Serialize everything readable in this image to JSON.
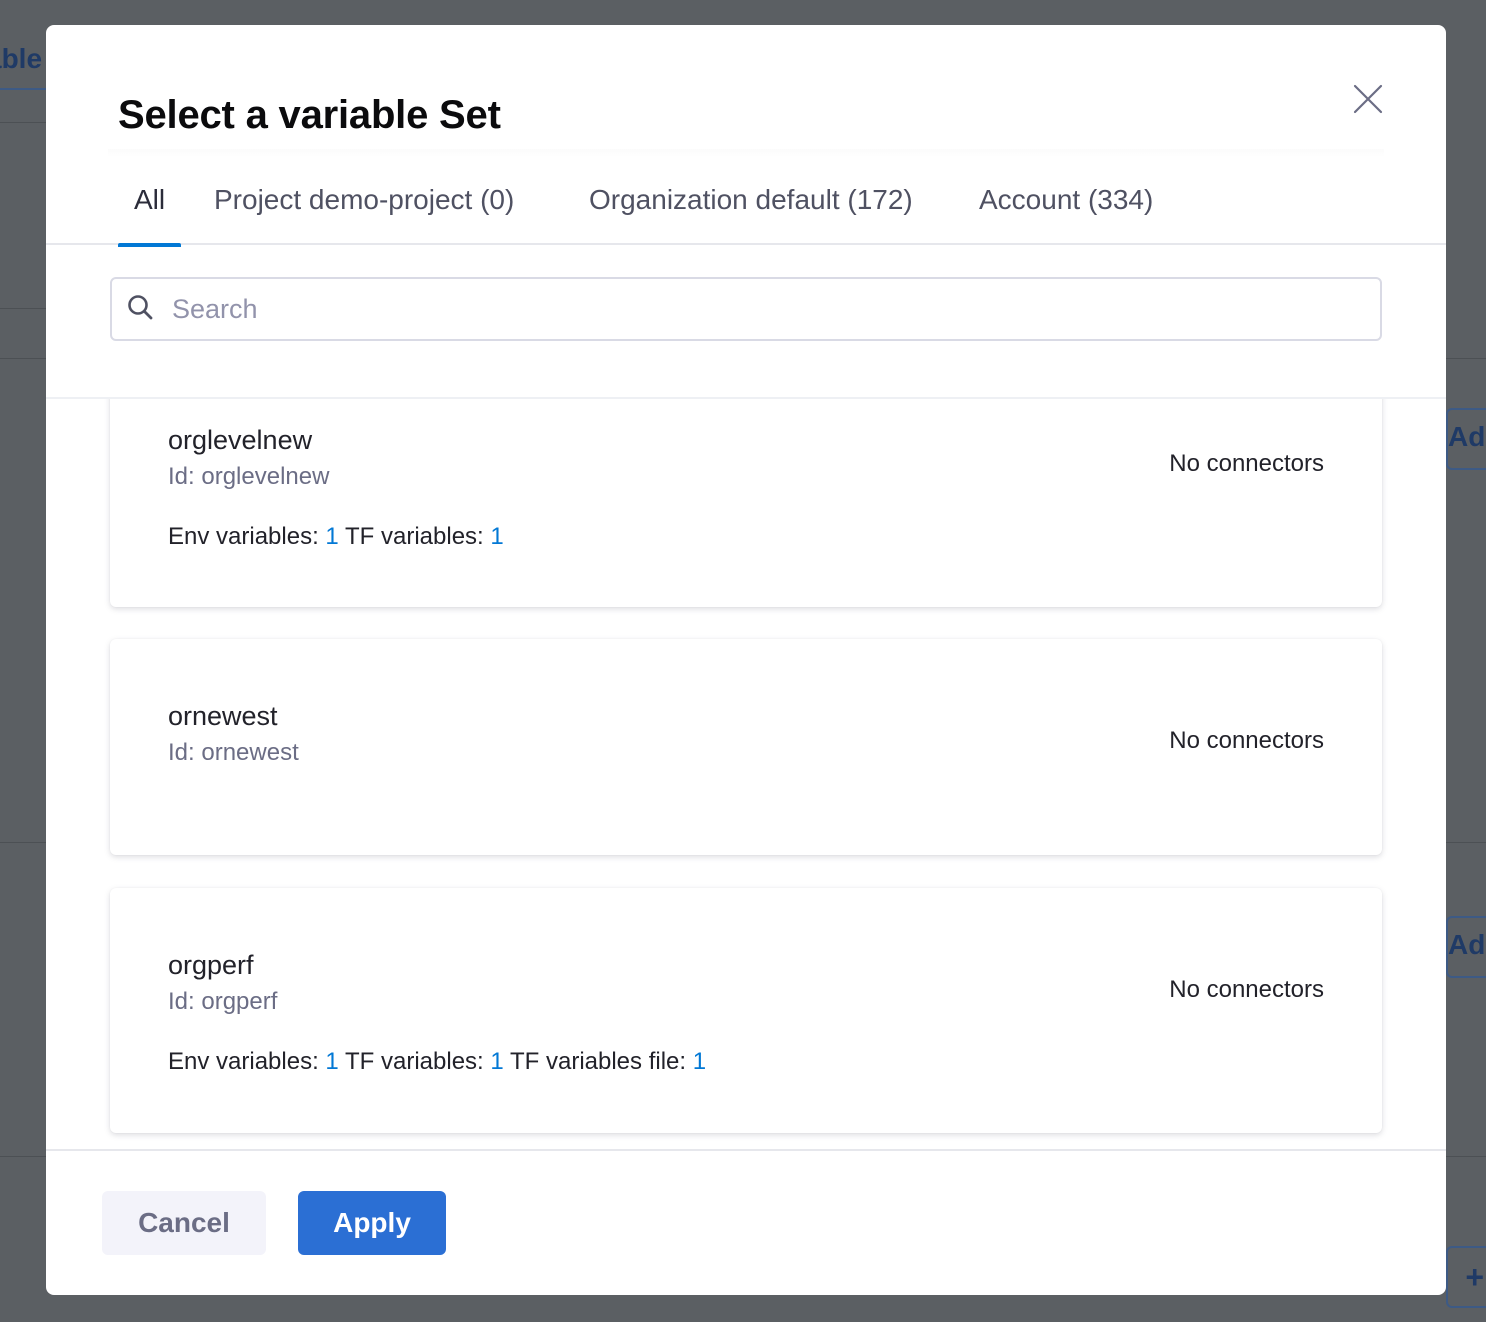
{
  "background": {
    "left_tab_fragment": "able",
    "right_button_fragment_1": "Add",
    "right_button_fragment_2": "Add",
    "right_button_fragment_3": "+"
  },
  "modal": {
    "title": "Select a variable Set",
    "close_icon": "close-icon",
    "tabs": [
      {
        "label": "All",
        "active": true
      },
      {
        "label": "Project demo-project (0)",
        "active": false
      },
      {
        "label": "Organization default (172)",
        "active": false
      },
      {
        "label": "Account (334)",
        "active": false
      }
    ],
    "search": {
      "placeholder": "Search",
      "value": ""
    },
    "items": [
      {
        "name": "orglevelnew",
        "id_text": "Id: orglevelnew",
        "connectors": "No connectors",
        "vars": {
          "env_label": "Env variables:",
          "env_count": "1",
          "tf_label": "TF variables:",
          "tf_count": "1"
        }
      },
      {
        "name": "ornewest",
        "id_text": "Id: ornewest",
        "connectors": "No connectors"
      },
      {
        "name": "orgperf",
        "id_text": "Id: orgperf",
        "connectors": "No connectors",
        "vars": {
          "env_label": "Env variables:",
          "env_count": "1",
          "tf_label": "TF variables:",
          "tf_count": "1",
          "tffile_label": "TF variables file:",
          "tffile_count": "1"
        }
      }
    ],
    "buttons": {
      "cancel": "Cancel",
      "apply": "Apply"
    },
    "colors": {
      "accent": "#0278d5",
      "apply_button": "#2b6fd4",
      "overlay": "#5b5f63"
    }
  }
}
